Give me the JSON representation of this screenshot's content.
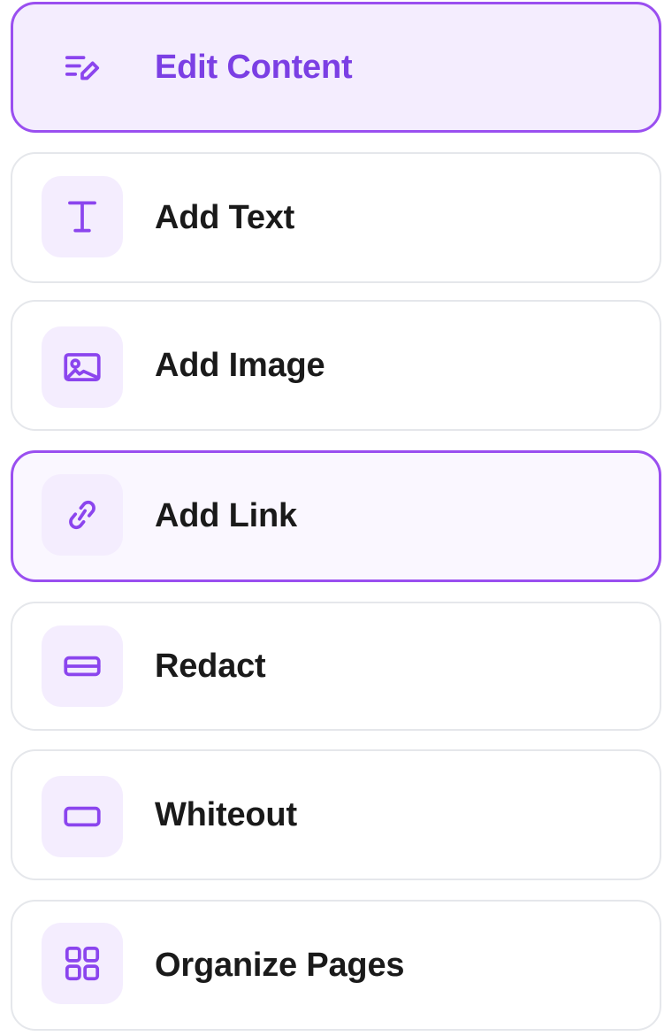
{
  "tools": {
    "accent_color": "#8b45ee",
    "active_text_color": "#7b3fe4",
    "items": [
      {
        "label": "Edit Content",
        "icon": "edit-content-icon",
        "state": "selected"
      },
      {
        "label": "Add Text",
        "icon": "text-icon",
        "state": "default"
      },
      {
        "label": "Add Image",
        "icon": "image-icon",
        "state": "default"
      },
      {
        "label": "Add Link",
        "icon": "link-icon",
        "state": "hovered"
      },
      {
        "label": "Redact",
        "icon": "redact-icon",
        "state": "default"
      },
      {
        "label": "Whiteout",
        "icon": "whiteout-icon",
        "state": "default"
      },
      {
        "label": "Organize Pages",
        "icon": "grid-icon",
        "state": "default"
      }
    ]
  }
}
